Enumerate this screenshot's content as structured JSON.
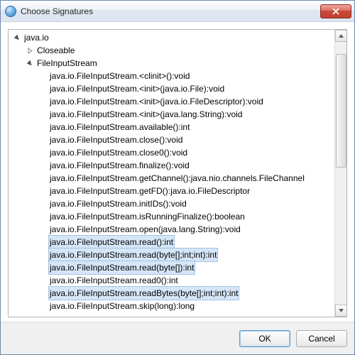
{
  "window": {
    "title": "Choose Signatures"
  },
  "tree": {
    "root": {
      "label": "java.io"
    },
    "children": [
      {
        "label": "Closeable"
      },
      {
        "label": "FileInputStream"
      }
    ],
    "signatures": [
      {
        "label": "java.io.FileInputStream.<clinit>():void",
        "selected": false
      },
      {
        "label": "java.io.FileInputStream.<init>(java.io.File):void",
        "selected": false
      },
      {
        "label": "java.io.FileInputStream.<init>(java.io.FileDescriptor):void",
        "selected": false
      },
      {
        "label": "java.io.FileInputStream.<init>(java.lang.String):void",
        "selected": false
      },
      {
        "label": "java.io.FileInputStream.available():int",
        "selected": false
      },
      {
        "label": "java.io.FileInputStream.close():void",
        "selected": false
      },
      {
        "label": "java.io.FileInputStream.close0():void",
        "selected": false
      },
      {
        "label": "java.io.FileInputStream.finalize():void",
        "selected": false
      },
      {
        "label": "java.io.FileInputStream.getChannel():java.nio.channels.FileChannel",
        "selected": false
      },
      {
        "label": "java.io.FileInputStream.getFD():java.io.FileDescriptor",
        "selected": false
      },
      {
        "label": "java.io.FileInputStream.initIDs():void",
        "selected": false
      },
      {
        "label": "java.io.FileInputStream.isRunningFinalize():boolean",
        "selected": false
      },
      {
        "label": "java.io.FileInputStream.open(java.lang.String):void",
        "selected": false
      },
      {
        "label": "java.io.FileInputStream.read():int",
        "selected": true
      },
      {
        "label": "java.io.FileInputStream.read(byte[];int;int):int",
        "selected": true
      },
      {
        "label": "java.io.FileInputStream.read(byte[]):int",
        "selected": true
      },
      {
        "label": "java.io.FileInputStream.read0():int",
        "selected": false
      },
      {
        "label": "java.io.FileInputStream.readBytes(byte[];int;int):int",
        "selected": true
      },
      {
        "label": "java.io.FileInputStream.skip(long):long",
        "selected": false
      }
    ]
  },
  "buttons": {
    "ok": "OK",
    "cancel": "Cancel"
  }
}
